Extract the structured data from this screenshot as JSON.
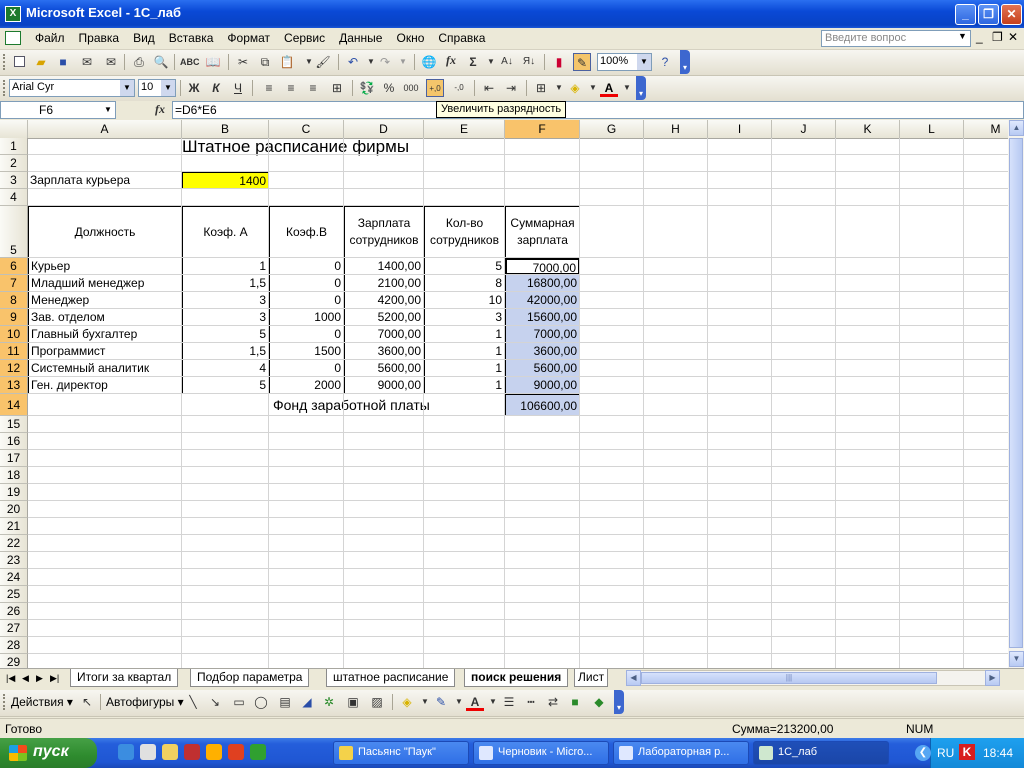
{
  "window": {
    "title": "Microsoft Excel - 1C_лаб",
    "app_icon": "X"
  },
  "menu": {
    "items": [
      "Файл",
      "Правка",
      "Вид",
      "Вставка",
      "Формат",
      "Сервис",
      "Данные",
      "Окно",
      "Справка"
    ],
    "help_placeholder": "Введите вопрос"
  },
  "toolbar": {
    "zoom": "100%"
  },
  "format_toolbar": {
    "font_name": "Arial Cyr",
    "font_size": "10",
    "bold": "Ж",
    "italic": "К",
    "underline": "Ч",
    "percent": "%",
    "thousands": "000"
  },
  "formula_bar": {
    "name_box": "F6",
    "fx": "fx",
    "formula": "=D6*E6",
    "tooltip": "Увеличить разрядность"
  },
  "columns": [
    "A",
    "B",
    "C",
    "D",
    "E",
    "F",
    "G",
    "H",
    "I",
    "J",
    "K",
    "L",
    "M"
  ],
  "rows": [
    "1",
    "2",
    "3",
    "4",
    "5",
    "6",
    "7",
    "8",
    "9",
    "10",
    "11",
    "12",
    "13",
    "14",
    "15",
    "16",
    "17",
    "18",
    "19",
    "20",
    "21",
    "22",
    "23",
    "24",
    "25",
    "26",
    "27",
    "28",
    "29"
  ],
  "sheet": {
    "title": "Штатное расписание фирмы",
    "courier_label": "Зарплата курьера",
    "courier_value": "1400",
    "headers": {
      "a": "Должность",
      "b": "Коэф. А",
      "c": "Коэф.В",
      "d1": "Зарплата",
      "d2": "сотрудников",
      "e1": "Кол-во",
      "e2": "сотрудников",
      "f1": "Суммарная",
      "f2": "зарплата"
    },
    "table": [
      [
        "Курьер",
        "1",
        "0",
        "1400,00",
        "5",
        "7000,00"
      ],
      [
        "Младший менеджер",
        "1,5",
        "0",
        "2100,00",
        "8",
        "16800,00"
      ],
      [
        " Менеджер",
        "3",
        "0",
        "4200,00",
        "10",
        "42000,00"
      ],
      [
        "Зав. отделом",
        "3",
        "1000",
        "5200,00",
        "3",
        "15600,00"
      ],
      [
        "Главный бухгалтер",
        "5",
        "0",
        "7000,00",
        "1",
        "7000,00"
      ],
      [
        "Программист",
        "1,5",
        "1500",
        "3600,00",
        "1",
        "3600,00"
      ],
      [
        "Системный аналитик",
        "4",
        "0",
        "5600,00",
        "1",
        "5600,00"
      ],
      [
        "Ген. директор",
        "5",
        "2000",
        "9000,00",
        "1",
        "9000,00"
      ]
    ],
    "fund_label": "Фонд заработной платы",
    "fund_value": "106600,00"
  },
  "tabs": [
    "Итоги за квартал",
    "Подбор параметра",
    "штатное расписание",
    "поиск решения",
    "Лист"
  ],
  "drawing_toolbar": {
    "actions": "Действия ▾",
    "autoshapes": "Автофигуры ▾"
  },
  "status": {
    "ready": "Готово",
    "sum": "Сумма=213200,00",
    "num": "NUM"
  },
  "taskbar": {
    "start": "пуск",
    "tasks": [
      "Пасьянс \"Паук\"",
      "Черновик - Micro...",
      "Лабораторная р...",
      "1C_лаб"
    ],
    "lang": "RU",
    "time": "18:44"
  },
  "colors": {
    "highlight": "#ffff00",
    "selection": "#c6d2ee",
    "header_selected": "#f9c36b"
  }
}
